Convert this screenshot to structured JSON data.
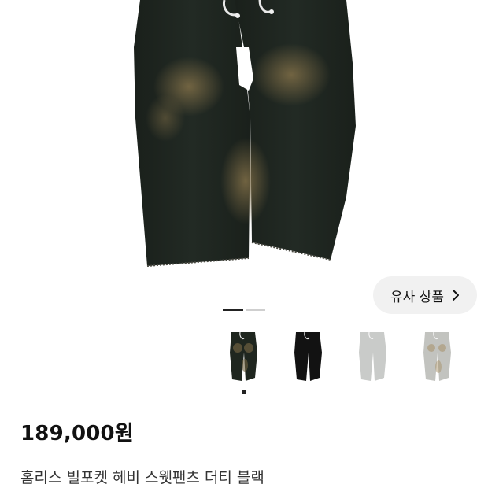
{
  "similar_button": {
    "label": "유사 상품",
    "icon": "chevron-right-icon"
  },
  "carousel": {
    "total_slides": 2,
    "active_slide": 1
  },
  "color_options": [
    {
      "name": "dirty-black",
      "swatch": "#1f261f",
      "selected": true
    },
    {
      "name": "black",
      "swatch": "#121212",
      "selected": false
    },
    {
      "name": "light-gray",
      "swatch": "#c9cbc9",
      "selected": false
    },
    {
      "name": "dirty-gray",
      "swatch": "#c2c3bf",
      "selected": false
    }
  ],
  "product": {
    "price": "189,000원",
    "title": "홈리스 빌포켓 헤비 스웻팬츠 더티 블랙"
  },
  "colors": {
    "accent": "#222222",
    "button_bg": "#f1f1f1"
  }
}
